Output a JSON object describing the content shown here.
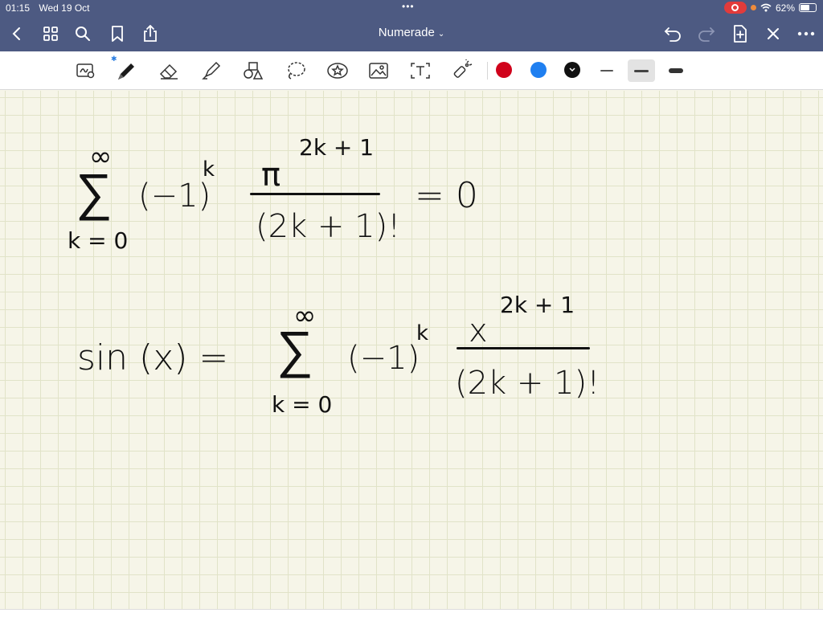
{
  "status_bar": {
    "time": "01:15",
    "date": "Wed 19 Oct",
    "battery_percent": "62%",
    "battery_level": 0.62
  },
  "nav": {
    "title": "Numerade",
    "title_caret": "⌄"
  },
  "toolbar": {
    "tools": [
      "handwriting-zoom-icon",
      "pen-icon",
      "eraser-icon",
      "highlighter-icon",
      "shapes-icon",
      "lasso-icon",
      "sticker-icon",
      "image-icon",
      "text-icon",
      "laser-pointer-icon"
    ],
    "selected_tool": "pen-icon",
    "colors": [
      "#d0021b",
      "#1f7ff0",
      "#111111"
    ],
    "selected_color": "#111111",
    "stroke_widths": [
      "thin",
      "medium",
      "thick"
    ],
    "selected_width": "medium"
  },
  "canvas": {
    "eq1": {
      "sum_symbol": "∑",
      "upper_limit": "∞",
      "lower_limit": "k = 0",
      "term_base": "(−1)",
      "term_exp": "k",
      "numerator_base": "π",
      "numerator_exp": "2k + 1",
      "denominator": "(2k + 1)!",
      "rhs": "= 0"
    },
    "eq2": {
      "lhs": "sin (x) =",
      "sum_symbol": "∑",
      "upper_limit": "∞",
      "lower_limit": "k = 0",
      "term_base": "(−1)",
      "term_exp": "k",
      "numerator_base": "x",
      "numerator_exp": "2k + 1",
      "denominator": "(2k + 1)!"
    }
  }
}
